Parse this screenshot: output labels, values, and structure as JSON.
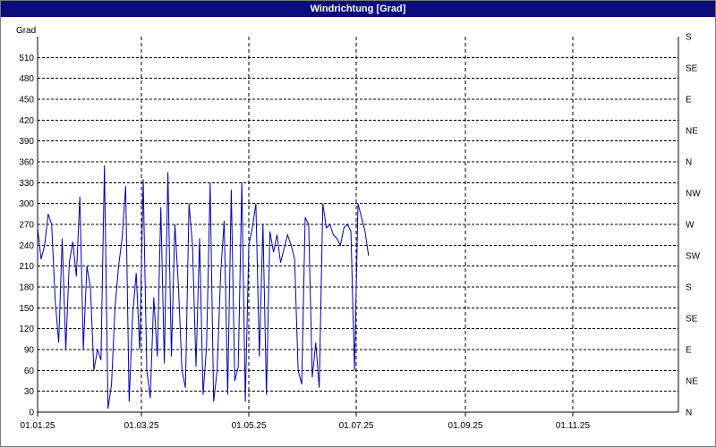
{
  "window": {
    "title": "Windrichtung [Grad]"
  },
  "chart_data": {
    "type": "line",
    "title": "Windrichtung [Grad]",
    "ylabel": "Grad",
    "ylim": [
      0,
      540
    ],
    "xlim": [
      "2025-01-01",
      "2025-12-31"
    ],
    "y_ticks": [
      0,
      30,
      60,
      90,
      120,
      150,
      180,
      210,
      240,
      270,
      300,
      330,
      360,
      390,
      420,
      450,
      480,
      510
    ],
    "x_ticks": [
      {
        "date": "2025-01-01",
        "label": "01.01.25"
      },
      {
        "date": "2025-03-01",
        "label": "01.03.25"
      },
      {
        "date": "2025-05-01",
        "label": "01.05.25"
      },
      {
        "date": "2025-07-01",
        "label": "01.07.25"
      },
      {
        "date": "2025-09-01",
        "label": "01.09.25"
      },
      {
        "date": "2025-11-01",
        "label": "01.11.25"
      }
    ],
    "right_axis_labels": [
      "N",
      "NE",
      "E",
      "SE",
      "S",
      "SW",
      "W",
      "NW",
      "N",
      "NE",
      "E",
      "SE",
      "S"
    ],
    "grid": true,
    "series_color": "#0000b4",
    "series": [
      {
        "x": [
          "2025-01-01",
          "2025-01-03",
          "2025-01-05",
          "2025-01-07",
          "2025-01-09",
          "2025-01-11",
          "2025-01-13",
          "2025-01-15",
          "2025-01-17",
          "2025-01-19",
          "2025-01-21",
          "2025-01-23",
          "2025-01-25",
          "2025-01-27",
          "2025-01-29",
          "2025-01-31",
          "2025-02-02",
          "2025-02-04",
          "2025-02-06",
          "2025-02-08",
          "2025-02-10",
          "2025-02-12",
          "2025-02-14",
          "2025-02-16",
          "2025-02-18",
          "2025-02-20",
          "2025-02-22",
          "2025-02-24",
          "2025-02-26",
          "2025-02-28",
          "2025-03-02",
          "2025-03-04",
          "2025-03-06",
          "2025-03-08",
          "2025-03-10",
          "2025-03-12",
          "2025-03-14",
          "2025-03-16",
          "2025-03-18",
          "2025-03-20",
          "2025-03-22",
          "2025-03-24",
          "2025-03-26",
          "2025-03-28",
          "2025-03-30",
          "2025-04-01",
          "2025-04-03",
          "2025-04-05",
          "2025-04-07",
          "2025-04-09",
          "2025-04-11",
          "2025-04-13",
          "2025-04-15",
          "2025-04-17",
          "2025-04-19",
          "2025-04-21",
          "2025-04-23",
          "2025-04-25",
          "2025-04-27",
          "2025-04-29",
          "2025-05-01",
          "2025-05-03",
          "2025-05-05",
          "2025-05-07",
          "2025-05-09",
          "2025-05-11",
          "2025-05-13",
          "2025-05-15",
          "2025-05-17",
          "2025-05-19",
          "2025-05-21",
          "2025-05-23",
          "2025-05-25",
          "2025-05-27",
          "2025-05-29",
          "2025-05-31",
          "2025-06-02",
          "2025-06-04",
          "2025-06-06",
          "2025-06-08",
          "2025-06-10",
          "2025-06-12",
          "2025-06-14",
          "2025-06-16",
          "2025-06-18",
          "2025-06-20",
          "2025-06-22",
          "2025-06-24",
          "2025-06-26",
          "2025-06-28",
          "2025-06-30",
          "2025-07-02",
          "2025-07-04",
          "2025-07-06",
          "2025-07-08"
        ],
        "values": [
          265,
          220,
          240,
          285,
          270,
          160,
          100,
          250,
          90,
          215,
          245,
          195,
          310,
          90,
          210,
          180,
          60,
          90,
          75,
          355,
          5,
          40,
          150,
          210,
          250,
          325,
          15,
          140,
          200,
          90,
          335,
          60,
          20,
          165,
          80,
          295,
          70,
          345,
          80,
          270,
          180,
          60,
          35,
          300,
          240,
          65,
          250,
          25,
          95,
          330,
          15,
          60,
          200,
          275,
          25,
          320,
          45,
          65,
          330,
          15,
          240,
          265,
          300,
          80,
          270,
          25,
          260,
          230,
          255,
          215,
          235,
          255,
          240,
          220,
          60,
          40,
          280,
          270,
          50,
          100,
          35,
          300,
          265,
          270,
          255,
          250,
          240,
          265,
          270,
          260,
          60,
          300,
          280,
          260,
          225
        ]
      }
    ]
  }
}
